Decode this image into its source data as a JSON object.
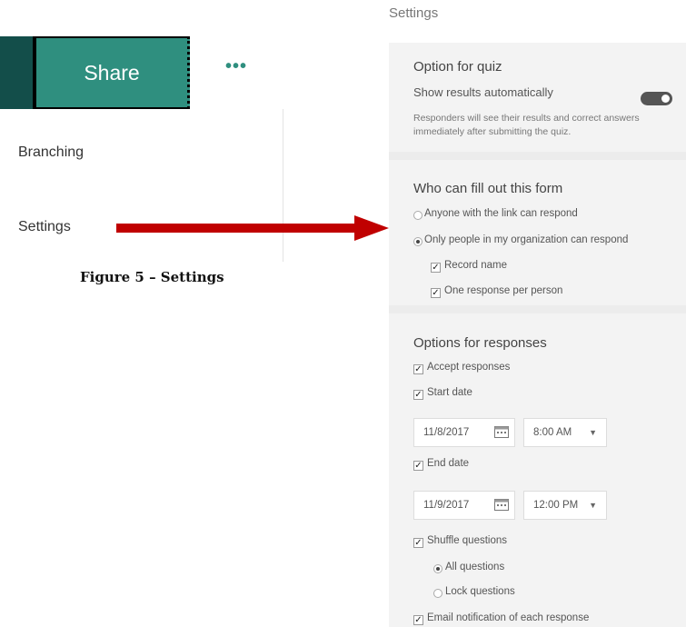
{
  "left": {
    "share_label": "Share",
    "more_label": "•••",
    "menu": [
      "Branching",
      "Settings"
    ],
    "caption": "Figure 5 – Settings",
    "arrow_color": "#c00000",
    "share_color": "#2f8f7f"
  },
  "settings": {
    "title": "Settings",
    "quiz": {
      "title": "Option for quiz",
      "toggle_label": "Show results automatically",
      "toggle_on": true,
      "desc": "Responders will see their results and correct answers immediately after submitting the quiz."
    },
    "who": {
      "title": "Who can fill out this form",
      "radio_anyone": "Anyone with the link can respond",
      "radio_org": "Only people in my organization can respond",
      "record_name": "Record name",
      "one_response": "One response per person"
    },
    "responses": {
      "title": "Options for responses",
      "accept": "Accept responses",
      "start_date": "Start date",
      "start_date_value": "11/8/2017",
      "start_time_value": "8:00 AM",
      "end_date": "End date",
      "end_date_value": "11/9/2017",
      "end_time_value": "12:00 PM",
      "shuffle": "Shuffle questions",
      "all_questions": "All questions",
      "lock_questions": "Lock questions",
      "email_notify": "Email notification of each response"
    }
  }
}
